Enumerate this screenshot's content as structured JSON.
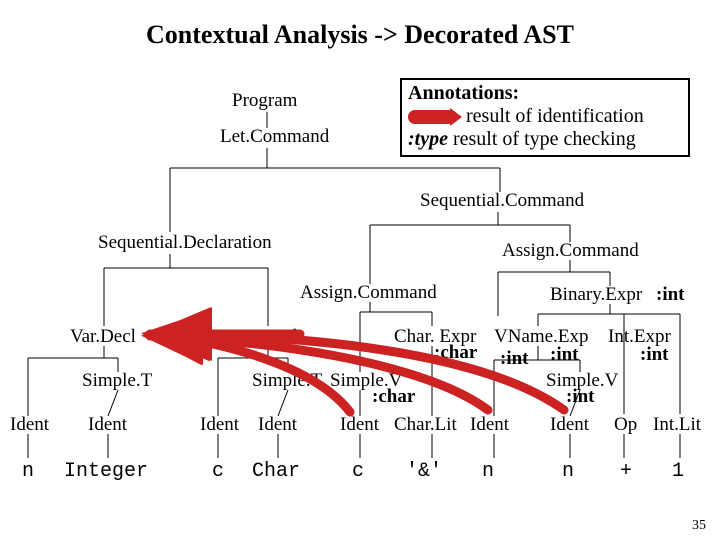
{
  "title": "Contextual Analysis -> Decorated AST",
  "annotations": {
    "heading": "Annotations:",
    "identification": "result of identification",
    "typePrefix": ":type",
    "typeText": " result of type checking"
  },
  "nodes": {
    "program": "Program",
    "letCommand": "Let.Command",
    "sequentialCommand": "Sequential.Command",
    "sequentialDeclaration": "Sequential.Declaration",
    "assignCommandRight": "Assign.Command",
    "assignCommandLeft": "Assign.Command",
    "binaryExpr": "Binary.Expr",
    "varDecl1": "Var.Decl",
    "varDecl2": "Var.Decl",
    "charExpr": "Char. Expr",
    "vnameExp": "VName.Exp",
    "intExpr": "Int.Expr",
    "simpleT1": "Simple.T",
    "simpleT2": "Simple.T",
    "simpleV1": "Simple.V",
    "simpleV2": "Simple.V",
    "ident1": "Ident",
    "ident2": "Ident",
    "ident3": "Ident",
    "ident4": "Ident",
    "ident5": "Ident",
    "charLit": "Char.Lit",
    "ident6": "Ident",
    "ident7": "Ident",
    "op": "Op",
    "intLit": "Int.Lit"
  },
  "leaves": {
    "n1": "n",
    "integer": "Integer",
    "c1": "c",
    "char": "Char",
    "c2": "c",
    "amp": "'&'",
    "n2": "n",
    "n3": "n",
    "plus": "+",
    "one": "1"
  },
  "typeAnnotations": {
    "binaryExpr": ":int",
    "charExpr": ":char",
    "vnameExp": ":int",
    "vnameExp2": ":int",
    "intExpr": ":int",
    "simpleV1": ":char",
    "simpleV2": ":int"
  },
  "pageNumber": "35"
}
